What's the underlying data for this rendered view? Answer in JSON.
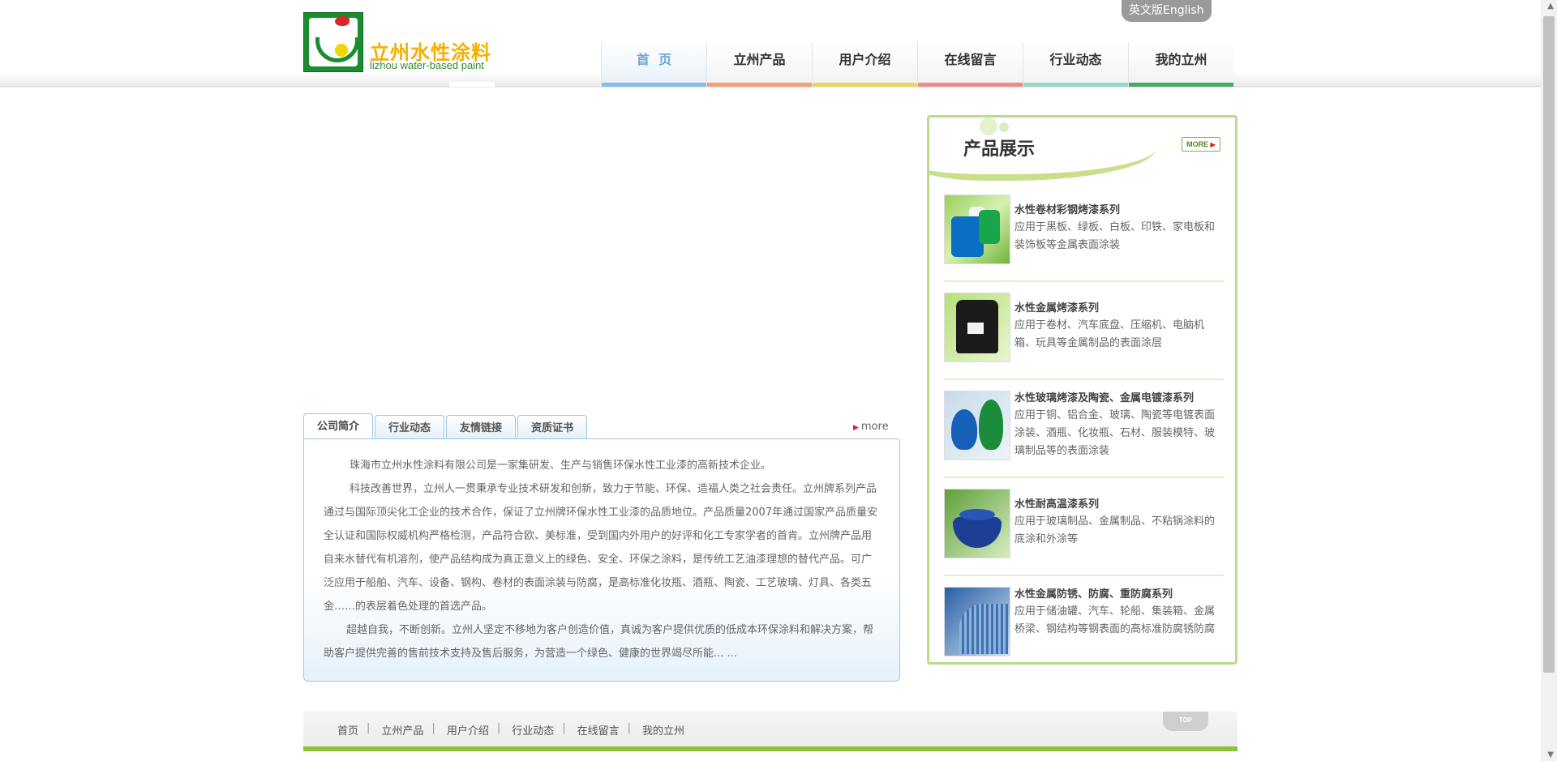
{
  "header": {
    "logo_cn": "立州水性涂料",
    "logo_en": "lizhou water-based paint",
    "lang_button": "英文版English"
  },
  "nav": {
    "items": [
      {
        "label": "首  页",
        "bar": "#86bde8",
        "active": true
      },
      {
        "label": "立州产品",
        "bar": "#f2a07a"
      },
      {
        "label": "用户介绍",
        "bar": "#ecd16a"
      },
      {
        "label": "在线留言",
        "bar": "#ee8a8a"
      },
      {
        "label": "行业动态",
        "bar": "#96d6c6"
      },
      {
        "label": "我的立州",
        "bar": "#45ab63"
      }
    ]
  },
  "tabs": {
    "items": [
      "公司简介",
      "行业动态",
      "友情链接",
      "资质证书"
    ],
    "more": "more"
  },
  "intro": {
    "paragraphs": [
      "珠海市立州水性涂料有限公司是一家集研发、生产与销售环保水性工业漆的高新技术企业。",
      "科技改善世界，立州人一贯秉承专业技术研发和创新，致力于节能、环保、造福人类之社会责任。立州牌系列产品通过与国际顶尖化工企业的技术合作，保证了立州牌环保水性工业漆的品质地位。产品质量2007年通过国家产品质量安全认证和国际权威机构严格检测，产品符合欧、美标准，受到国内外用户的好评和化工专家学者的首肯。立州牌产品用自来水替代有机溶剂，使产品结构成为真正意义上的绿色、安全、环保之涂料，是传统工艺油漆理想的替代产品。可广泛应用于船舶、汽车、设备、钢构、卷材的表面涂装与防腐，是高标准化妆瓶、酒瓶、陶瓷、工艺玻璃、灯具、各类五金……的表层着色处理的首选产品。",
      "超越自我，不断创新。立州人坚定不移地为客户创造价值，真诚为客户提供优质的低成本环保涂料和解决方案，帮助客户提供完善的售前技术支持及售后服务，为营造一个绿色、健康的世界竭尽所能... ..."
    ]
  },
  "products": {
    "title": "产品展示",
    "more": "MORE",
    "items": [
      {
        "name": "水性卷材彩钢烤漆系列",
        "desc": "应用于黑板、绿板、白板、印铁、家电板和装饰板等金属表面涂装",
        "icon": "coil-rolls-image"
      },
      {
        "name": "水性金属烤漆系列",
        "desc": "应用于卷材、汽车底盘、压缩机、电脑机箱、玩具等金属制品的表面涂层",
        "icon": "compressor-image"
      },
      {
        "name": "水性玻璃烤漆及陶瓷、金属电镀漆系列",
        "desc": "应用于铜、铝合金、玻璃、陶瓷等电镀表面涂装、酒瓶、化妆瓶、石材、服装模特、玻璃制品等的表面涂装",
        "icon": "glass-bottles-image"
      },
      {
        "name": "水性耐高温漆系列",
        "desc": "应用于玻璃制品、金属制品、不粘锅涂料的底涂和外涂等",
        "icon": "cookware-image"
      },
      {
        "name": "水性金属防锈、防腐、重防腐系列",
        "desc": "应用于储油罐、汽车、轮船、集装箱、金属桥梁、钢结构等钢表面的高标准防腐锈防腐",
        "icon": "steel-structure-image"
      }
    ]
  },
  "footer": {
    "links": [
      "首页",
      "立州产品",
      "用户介绍",
      "行业动态",
      "在线留言",
      "我的立州"
    ],
    "separator": "|",
    "top": "TOP"
  }
}
